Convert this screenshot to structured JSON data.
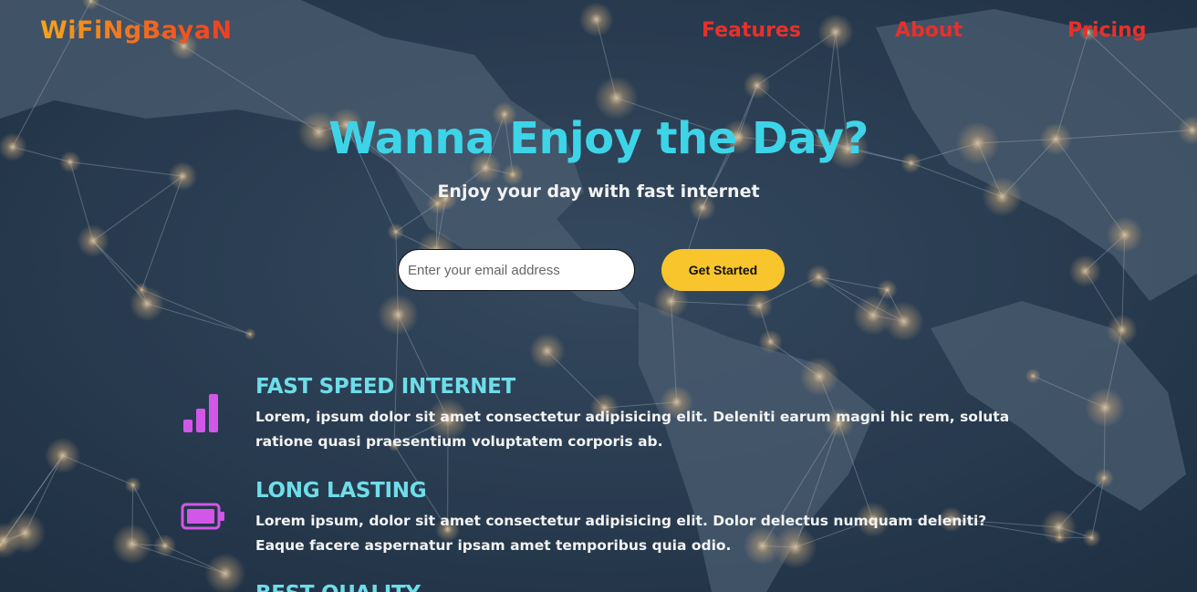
{
  "brand": {
    "logo_text": "WiFiNgBayaN"
  },
  "nav": {
    "items": [
      {
        "label": "Features"
      },
      {
        "label": "About"
      },
      {
        "label": "Pricing"
      }
    ]
  },
  "hero": {
    "title": "Wanna Enjoy the Day?",
    "subtitle": "Enjoy your day with fast internet"
  },
  "signup": {
    "email_placeholder": "Enter your email address",
    "email_value": "",
    "button_label": "Get Started"
  },
  "features": [
    {
      "icon": "signal-bars-icon",
      "title": "FAST SPEED INTERNET",
      "description": "Lorem, ipsum dolor sit amet consectetur adipisicing elit. Deleniti earum magni hic rem, soluta ratione quasi praesentium voluptatem corporis ab."
    },
    {
      "icon": "battery-icon",
      "title": "LONG LASTING",
      "description": "Lorem ipsum, dolor sit amet consectetur adipisicing elit. Dolor delectus numquam deleniti? Eaque facere aspernatur ipsam amet temporibus quia odio."
    },
    {
      "icon": "",
      "title": "BEST QUALITY",
      "description": ""
    }
  ],
  "colors": {
    "logo_gradient": [
      "#f4a51c",
      "#ee3d22"
    ],
    "nav": "#e8302a",
    "hero_title": "#3ed4e8",
    "cta": "#f8c52c",
    "feature_title": "#6fdde8",
    "feature_icon": "#d257e8",
    "background": "#2c3f52"
  }
}
